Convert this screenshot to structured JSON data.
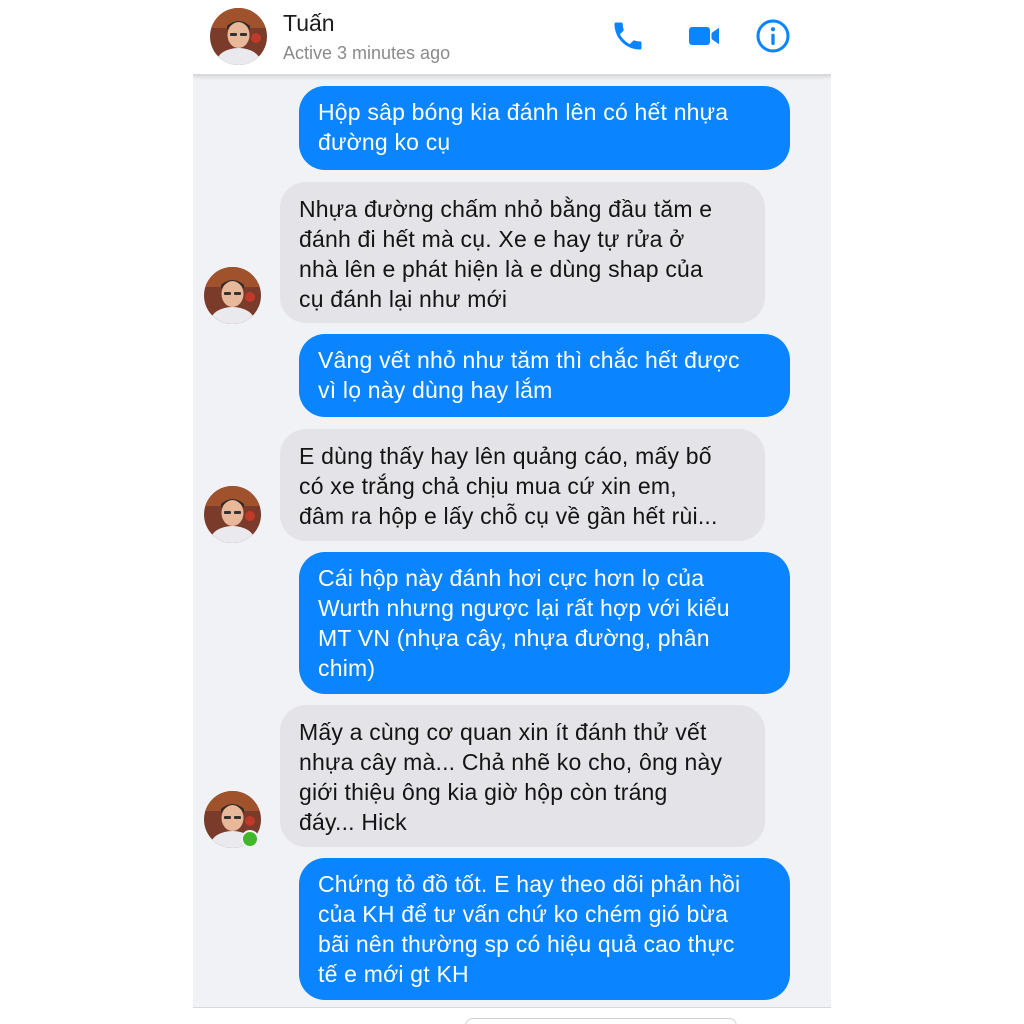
{
  "header": {
    "contact_name": "Tuấn",
    "status": "Active 3 minutes ago",
    "icons": [
      "phone-icon",
      "video-camera-icon",
      "info-icon"
    ]
  },
  "colors": {
    "accent": "#0a84ff",
    "incoming_bubble": "#e3e3e8",
    "online": "#42b72a"
  },
  "messages": [
    {
      "from": "me",
      "text": "Hộp sâp bóng kia đánh lên có hết nhựa\nđường ko cụ"
    },
    {
      "from": "Tuấn",
      "text": "Nhựa đường chấm nhỏ bằng đầu tăm e\nđánh đi hết mà cụ. Xe e hay tự rửa ở\nnhà lên e phát hiện là e dùng shap của\ncụ đánh lại như mới"
    },
    {
      "from": "me",
      "text": "Vâng vết nhỏ như tăm thì chắc hết được\nvì lọ này dùng hay lắm"
    },
    {
      "from": "Tuấn",
      "text": "E dùng thấy hay lên quảng cáo, mấy bố\ncó xe trắng chả chịu mua cứ xin em,\nđâm ra hộp e lấy chỗ cụ về gần hết rùi..."
    },
    {
      "from": "me",
      "text": "Cái hộp này đánh hơi cực hơn lọ của\nWurth nhưng ngược lại rất hợp với kiểu\nMT VN (nhựa cây, nhựa đường, phân\nchim)"
    },
    {
      "from": "Tuấn",
      "text": "Mấy a cùng cơ quan xin ít đánh thử vết\nnhựa cây mà... Chả nhẽ ko cho, ông này\ngiới thiệu ông kia giờ hộp còn tráng\nđáy... Hick"
    },
    {
      "from": "me",
      "text": "Chứng tỏ đồ tốt. E hay theo dõi phản hồi\ncủa KH để tư vấn chứ ko chém gió bừa\nbãi nên thường sp có hiệu quả cao thực\ntế e mới gt KH"
    }
  ]
}
